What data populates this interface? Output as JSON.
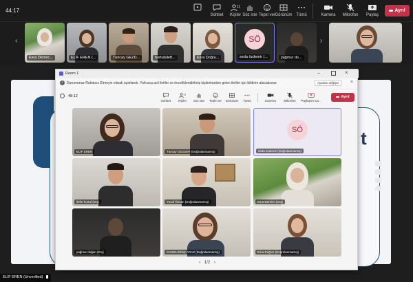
{
  "outer": {
    "timer": "44:17",
    "toolbar": {
      "chat": "Sohbet",
      "people": "Kişiler",
      "people_count": "11",
      "raise": "Söz iste",
      "react": "Tepki ver",
      "view": "Görünüm",
      "more": "Tümü",
      "camera": "Kamera",
      "mic": "Mikrofon",
      "share": "Paylaş",
      "leave": "Ayrıl"
    },
    "thumbnails": [
      "Esra Demirc...",
      "ELİF EREN (...",
      "Tuncay GEZD...",
      "hortulisleft...",
      "Esra Doğru...",
      "seda özdemir (...",
      "yağmur do...",
      ""
    ],
    "avatar_initials": "SÖ",
    "shared_fragment": "t",
    "bottom_name": "ELİF EREN (Unverified)"
  },
  "inner": {
    "window_title": "Room 1",
    "info_text": "Durumunuz Rahatsız Etmeyin olarak ayarlandı. Yalnızca acil iletiler ve önceliklendirilmiş kişilerinizden gelen iletiler için bildirim alacaksınız.",
    "info_button": "Ayarları değiştir",
    "timer": "48:12",
    "toolbar": {
      "chat": "Sohbet",
      "people": "Kişiler",
      "people_count": "11",
      "raise": "Söz iste",
      "react": "Tepki ver",
      "view": "Görünüm",
      "more": "Tümü",
      "camera": "Kamera",
      "mic": "Mikrofon",
      "share": "Paylaşım iça...",
      "leave": "Ayrıl"
    },
    "participants": [
      "ELİF EREN",
      "Tuncay GEZDER (Doğrulanmamış)",
      "seda özdemir (Doğrulanmamış)",
      "ilefet hurtul (Dış)",
      "Yusuf Özcan (Doğrulanmamış)",
      "Esra Demirci (Dış)",
      "yağmur doğan (Dış)",
      "CANSU DİNÇ ARAZ (Doğrulanmamış)",
      "Esra Doğrar (Doğrulanmamış)"
    ],
    "avatar_initials": "SÖ",
    "pagination": "1/2"
  },
  "colors": {
    "leave": "#c4314b",
    "accent": "#5b5fc7",
    "avatar_bg": "#f6d3d9",
    "avatar_text": "#8e2b3d"
  }
}
